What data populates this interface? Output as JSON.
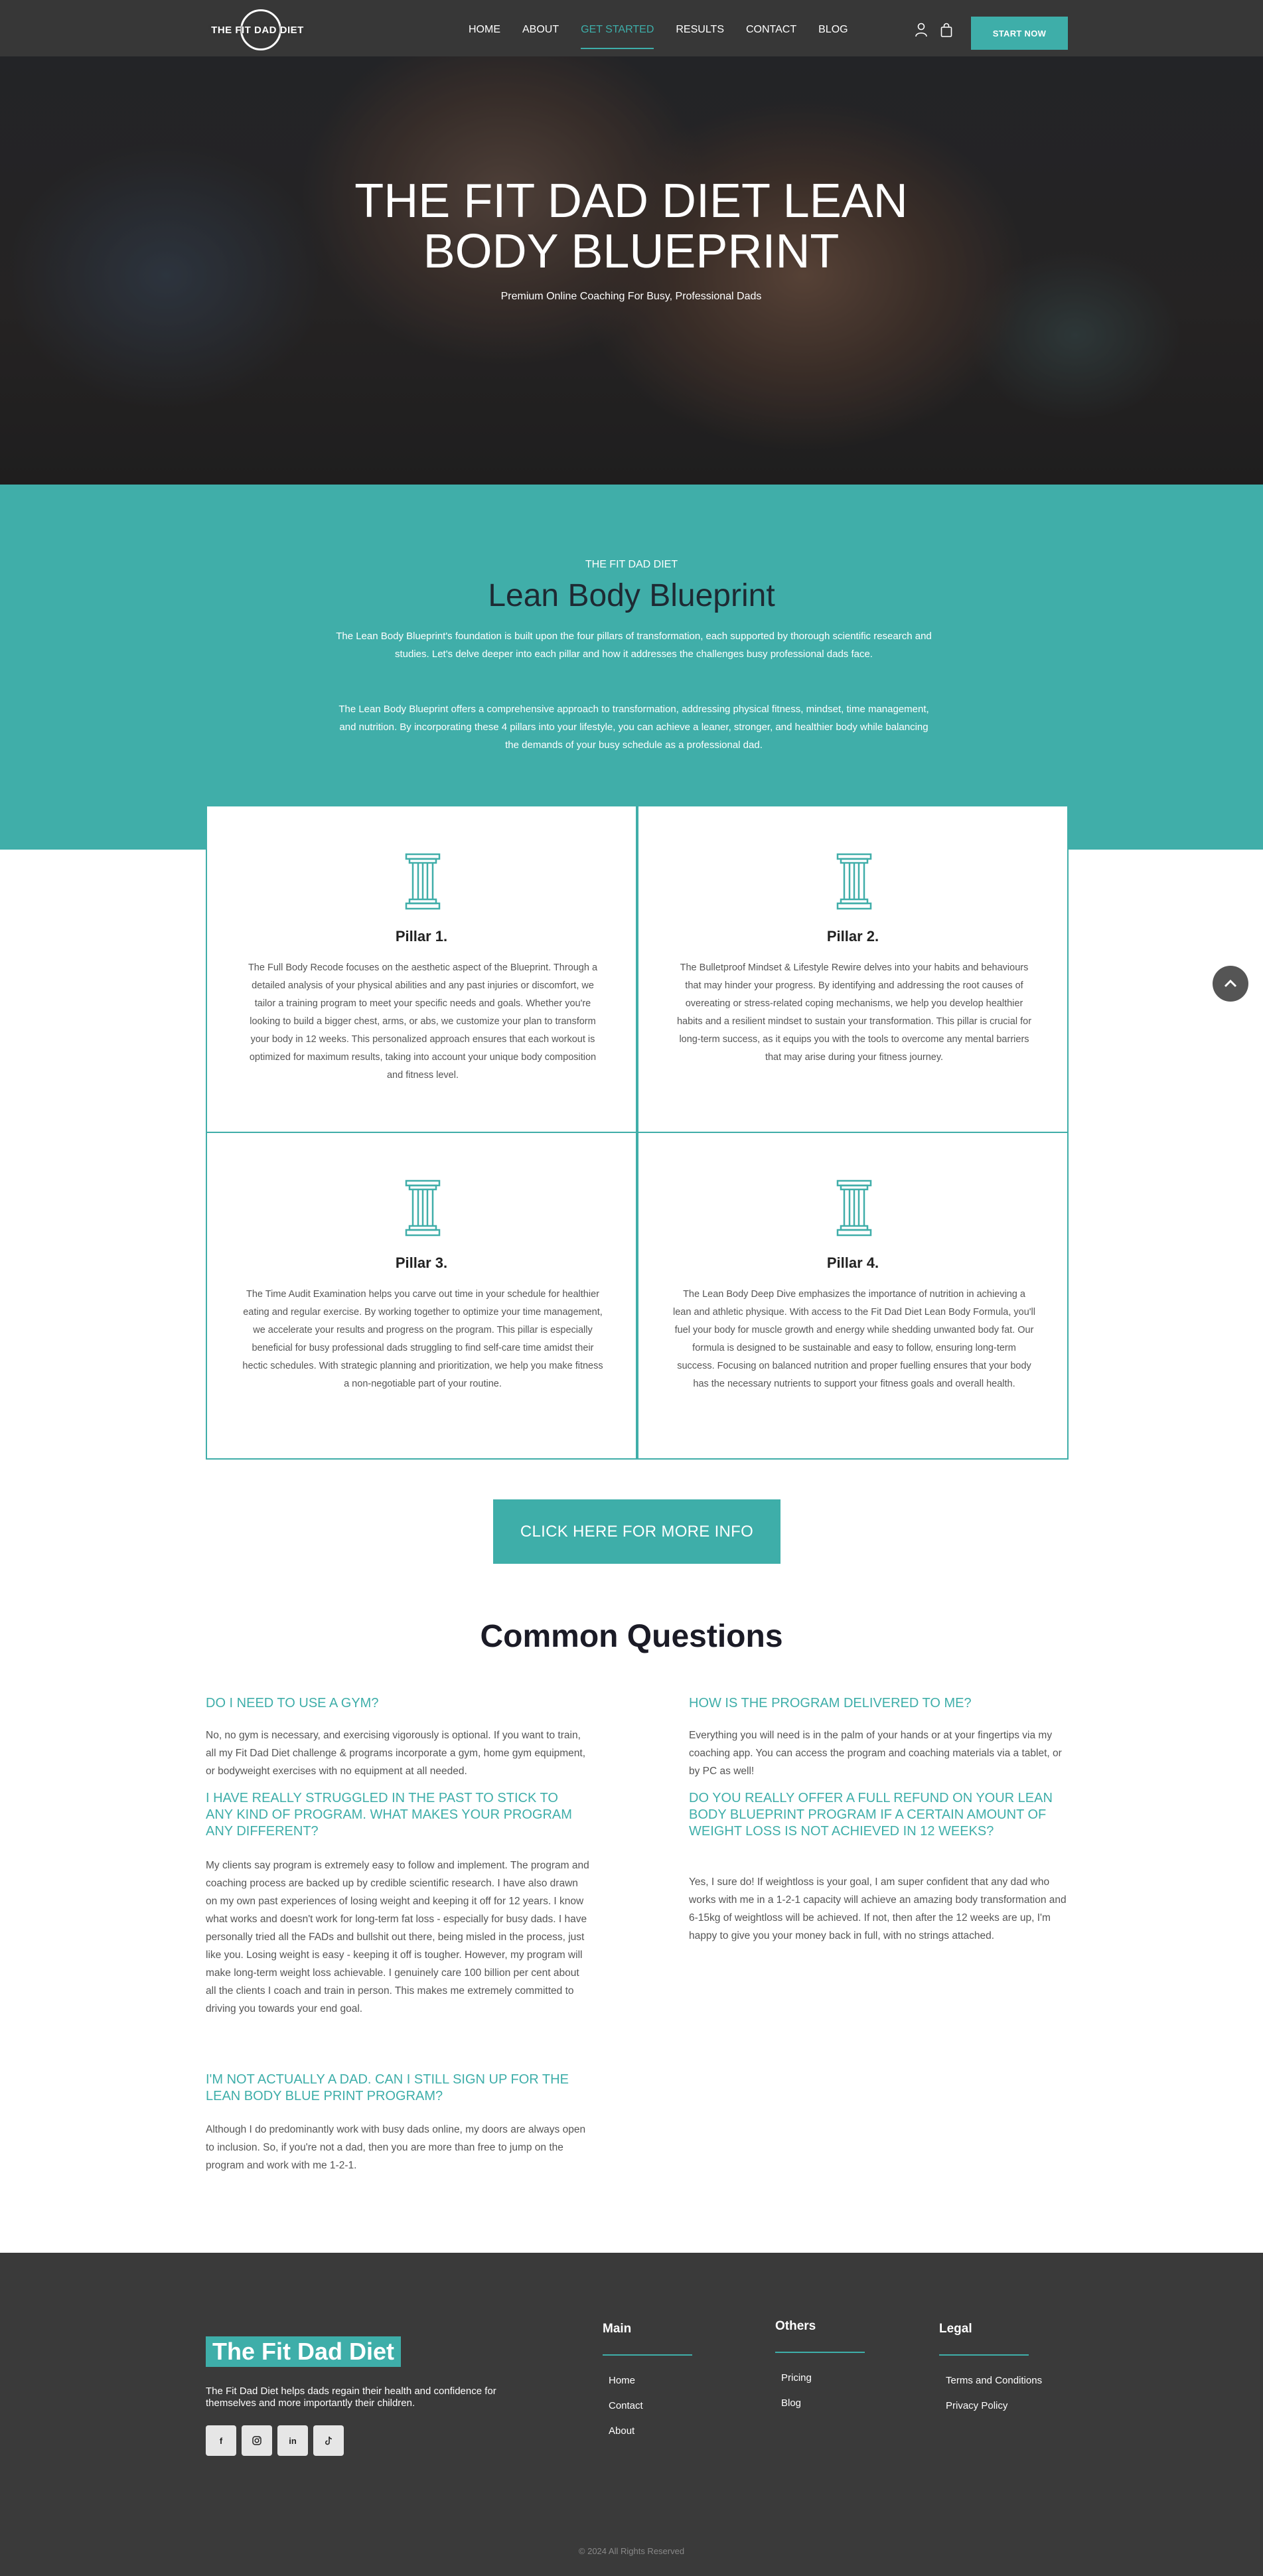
{
  "header": {
    "logo_text": "THE FIT DAD DIET",
    "nav": [
      "HOME",
      "ABOUT",
      "GET STARTED",
      "RESULTS",
      "CONTACT",
      "BLOG"
    ],
    "active_nav": "GET STARTED",
    "cta_label": "START NOW",
    "icons": [
      "user-icon",
      "shopping-bag-icon"
    ]
  },
  "hero": {
    "title": "THE FIT DAD DIET LEAN BODY BLUEPRINT",
    "subtitle": "Premium Online Coaching For Busy, Professional Dads"
  },
  "intro": {
    "eyebrow": "THE FIT DAD DIET",
    "title": "Lean Body Blueprint",
    "paragraph1": "The Lean Body Blueprint's foundation is built upon the four pillars of transformation, each supported by thorough scientific research and studies. Let's delve deeper into each pillar and how it addresses the challenges busy professional dads face.",
    "paragraph2": "The Lean Body Blueprint offers a comprehensive approach to transformation, addressing physical fitness, mindset, time management, and nutrition. By incorporating these 4 pillars into your lifestyle, you can achieve a leaner, stronger, and healthier body while balancing the demands of your busy schedule as a professional dad."
  },
  "pillars": [
    {
      "title": "Pillar 1.",
      "text": "The Full Body Recode focuses on the aesthetic aspect of the Blueprint. Through a detailed analysis of your physical abilities and any past injuries or discomfort, we tailor a training program to meet your specific needs and goals. Whether you're looking to build a bigger chest, arms, or abs, we customize your plan to transform your body in 12 weeks. This personalized approach ensures that each workout is optimized for maximum results, taking into account your unique body composition and fitness level."
    },
    {
      "title": "Pillar 2.",
      "text": "The Bulletproof Mindset & Lifestyle Rewire delves into your habits and behaviours that may hinder your progress. By identifying and addressing the root causes of overeating or stress-related coping mechanisms, we help you develop healthier habits and a resilient mindset to sustain your transformation. This pillar is crucial for long-term success, as it equips you with the tools to overcome any mental barriers that may arise during your fitness journey."
    },
    {
      "title": "Pillar 3.",
      "text": "The Time Audit Examination helps you carve out time in your schedule for healthier eating and regular exercise. By working together to optimize your time management, we accelerate your results and progress on the program. This pillar is especially beneficial for busy professional dads struggling to find self-care time amidst their hectic schedules. With strategic planning and prioritization, we help you make fitness a non-negotiable part of your routine."
    },
    {
      "title": "Pillar 4.",
      "text": "The Lean Body Deep Dive emphasizes the importance of nutrition in achieving a lean and athletic physique. With access to the Fit Dad Diet Lean Body Formula, you'll fuel your body for muscle growth and energy while shedding unwanted body fat. Our formula is designed to be sustainable and easy to follow, ensuring long-term success. Focusing on balanced nutrition and proper fuelling ensures that your body has the necessary nutrients to support your fitness goals and overall health."
    }
  ],
  "cta": {
    "label": "CLICK HERE FOR MORE INFO"
  },
  "faq": {
    "title": "Common Questions",
    "items": [
      {
        "q": "DO I NEED TO USE A GYM?",
        "a": "No, no gym is necessary, and exercising vigorously is optional. If you want to train, all my Fit Dad Diet challenge & programs incorporate a gym, home gym equipment, or bodyweight exercises with no equipment at all needed."
      },
      {
        "q": "HOW IS THE PROGRAM DELIVERED TO ME?",
        "a": "Everything you will need is in the palm of your hands or at your fingertips via my coaching app. You can access the program and coaching materials via a tablet, or by PC as well!"
      },
      {
        "q": "I HAVE REALLY STRUGGLED IN THE PAST TO STICK TO ANY KIND OF PROGRAM. WHAT MAKES YOUR PROGRAM ANY DIFFERENT?",
        "a": "My clients say program is extremely easy to follow and implement. The program and coaching process are backed up by credible scientific research. I have also drawn on my own past experiences of losing weight and keeping it off for 12 years. I know what works and doesn't work for long-term fat loss - especially for busy dads. I have personally tried all the FADs and bullshit out there, being misled in the process, just like you. Losing weight is easy - keeping it off is tougher. However, my program will make long-term weight loss achievable. I genuinely care 100 billion per cent about all the clients I coach and train in person. This makes me extremely committed to driving you towards your end goal."
      },
      {
        "q": "DO YOU REALLY OFFER A FULL REFUND ON YOUR LEAN BODY BLUEPRINT PROGRAM IF A CERTAIN AMOUNT OF WEIGHT LOSS IS NOT ACHIEVED IN 12 WEEKS?",
        "a": "Yes, I sure do! If weightloss is your goal, I am super confident that any dad who works with me in a 1-2-1 capacity will achieve an amazing body transformation and 6-15kg of weightloss will be achieved. If not, then after the 12 weeks are up, I'm happy to give you your money back in full, with no strings attached."
      },
      {
        "q": "I'M NOT ACTUALLY A DAD. CAN I STILL SIGN UP FOR THE LEAN BODY BLUE PRINT PROGRAM?",
        "a": "Although I do predominantly work with busy dads online, my doors are always open to inclusion. So, if you're not a dad, then you are more than free to jump on the program and work with me 1-2-1."
      }
    ]
  },
  "footer": {
    "brand": "The Fit Dad Diet",
    "description": "The Fit Dad Diet helps dads regain their health and confidence for themselves and more importantly their children.",
    "socials": [
      "facebook-icon",
      "instagram-icon",
      "linkedin-icon",
      "tiktok-icon"
    ],
    "columns": [
      {
        "heading": "Main",
        "links": [
          "Home",
          "Contact",
          "About"
        ]
      },
      {
        "heading": "Others",
        "links": [
          "Pricing",
          "Blog"
        ]
      },
      {
        "heading": "Legal",
        "links": [
          "Terms and Conditions",
          "Privacy Policy"
        ]
      }
    ],
    "copyright": "© 2024 All Rights Reserved"
  },
  "colors": {
    "accent": "#40aea9",
    "header": "#373737",
    "footer": "#3a3a3a"
  }
}
